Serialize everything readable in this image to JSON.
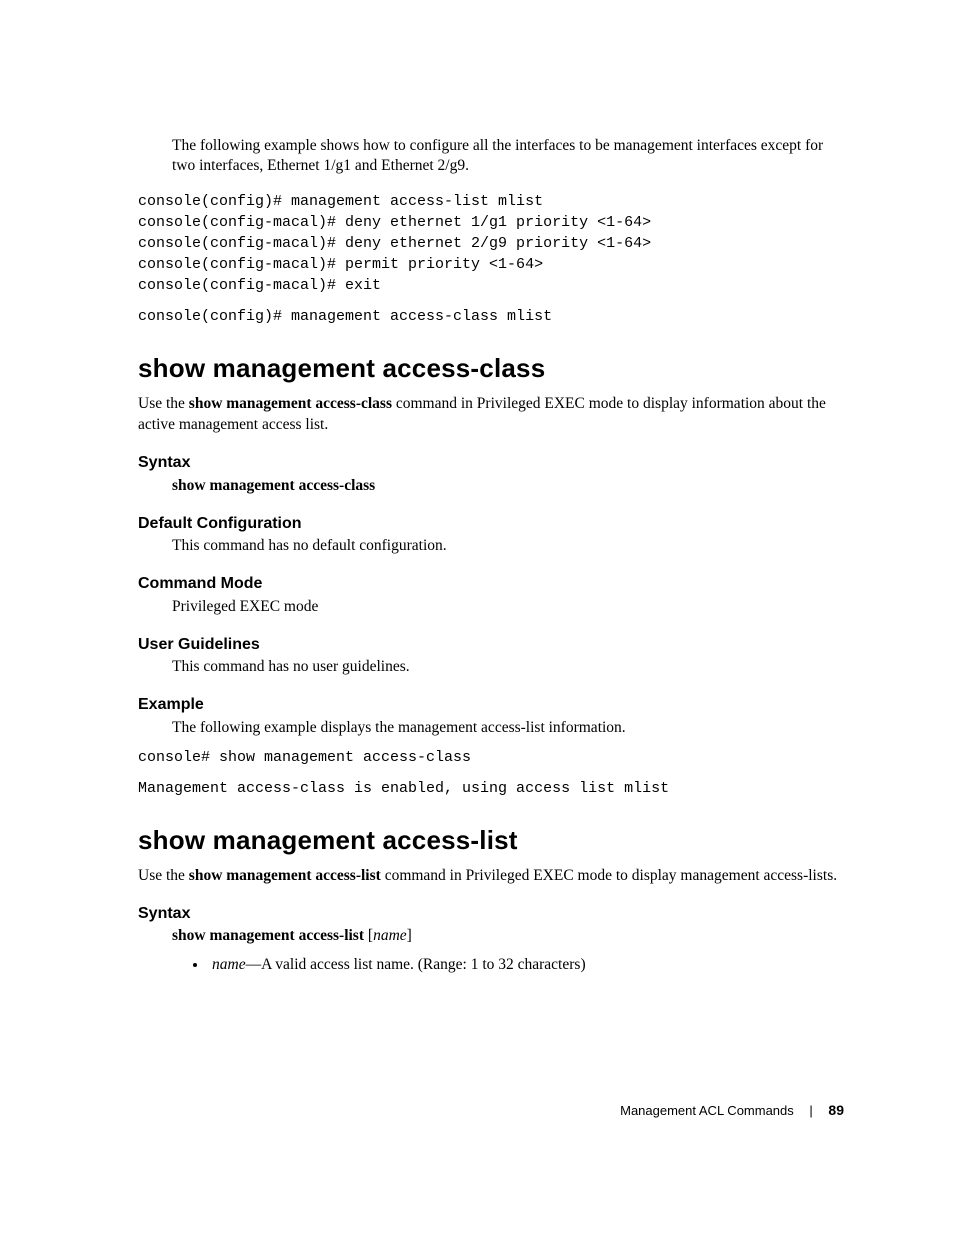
{
  "intro_text": "The following example shows how to configure all the interfaces to be management interfaces except for two interfaces, Ethernet 1/g1 and Ethernet 2/g9.",
  "code_block1": "console(config)# management access-list mlist\nconsole(config-macal)# deny ethernet 1/g1 priority <1-64>\nconsole(config-macal)# deny ethernet 2/g9 priority <1-64>\nconsole(config-macal)# permit priority <1-64>\nconsole(config-macal)# exit",
  "code_block1b": "console(config)# management access-class mlist",
  "section1": {
    "heading": "show management access-class",
    "desc_pre": "Use the ",
    "desc_cmd": "show management access-class",
    "desc_post": " command in Privileged EXEC mode to display information about the active management access list.",
    "syntax_label": "Syntax",
    "syntax_text": "show management access-class",
    "defcfg_label": "Default Configuration",
    "defcfg_text": "This command has no default configuration.",
    "mode_label": "Command Mode",
    "mode_text": "Privileged EXEC mode",
    "guide_label": "User Guidelines",
    "guide_text": "This command has no user guidelines.",
    "example_label": "Example",
    "example_text": "The following example displays the management access-list information.",
    "example_code1": "console# show management access-class",
    "example_code2": "Management access-class is enabled, using access list mlist"
  },
  "section2": {
    "heading": "show management access-list",
    "desc_pre": "Use the ",
    "desc_cmd": "show management access-list",
    "desc_post": " command in Privileged EXEC mode to display management access-lists.",
    "syntax_label": "Syntax",
    "syntax_text": "show management access-list",
    "syntax_arg": "name",
    "bullet_term": "name",
    "bullet_rest": "—A valid access list name. (Range: 1 to 32 characters)"
  },
  "footer": {
    "title": "Management ACL Commands",
    "page": "89"
  }
}
